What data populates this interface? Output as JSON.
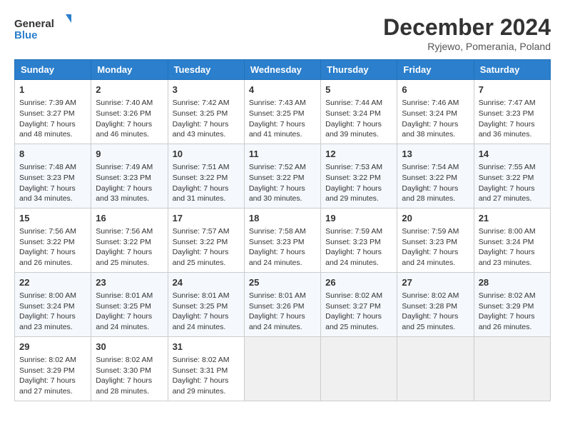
{
  "header": {
    "logo_line1": "General",
    "logo_line2": "Blue",
    "month": "December 2024",
    "location": "Ryjewo, Pomerania, Poland"
  },
  "weekdays": [
    "Sunday",
    "Monday",
    "Tuesday",
    "Wednesday",
    "Thursday",
    "Friday",
    "Saturday"
  ],
  "weeks": [
    [
      {
        "day": "1",
        "sunrise": "Sunrise: 7:39 AM",
        "sunset": "Sunset: 3:27 PM",
        "daylight": "Daylight: 7 hours and 48 minutes."
      },
      {
        "day": "2",
        "sunrise": "Sunrise: 7:40 AM",
        "sunset": "Sunset: 3:26 PM",
        "daylight": "Daylight: 7 hours and 46 minutes."
      },
      {
        "day": "3",
        "sunrise": "Sunrise: 7:42 AM",
        "sunset": "Sunset: 3:25 PM",
        "daylight": "Daylight: 7 hours and 43 minutes."
      },
      {
        "day": "4",
        "sunrise": "Sunrise: 7:43 AM",
        "sunset": "Sunset: 3:25 PM",
        "daylight": "Daylight: 7 hours and 41 minutes."
      },
      {
        "day": "5",
        "sunrise": "Sunrise: 7:44 AM",
        "sunset": "Sunset: 3:24 PM",
        "daylight": "Daylight: 7 hours and 39 minutes."
      },
      {
        "day": "6",
        "sunrise": "Sunrise: 7:46 AM",
        "sunset": "Sunset: 3:24 PM",
        "daylight": "Daylight: 7 hours and 38 minutes."
      },
      {
        "day": "7",
        "sunrise": "Sunrise: 7:47 AM",
        "sunset": "Sunset: 3:23 PM",
        "daylight": "Daylight: 7 hours and 36 minutes."
      }
    ],
    [
      {
        "day": "8",
        "sunrise": "Sunrise: 7:48 AM",
        "sunset": "Sunset: 3:23 PM",
        "daylight": "Daylight: 7 hours and 34 minutes."
      },
      {
        "day": "9",
        "sunrise": "Sunrise: 7:49 AM",
        "sunset": "Sunset: 3:23 PM",
        "daylight": "Daylight: 7 hours and 33 minutes."
      },
      {
        "day": "10",
        "sunrise": "Sunrise: 7:51 AM",
        "sunset": "Sunset: 3:22 PM",
        "daylight": "Daylight: 7 hours and 31 minutes."
      },
      {
        "day": "11",
        "sunrise": "Sunrise: 7:52 AM",
        "sunset": "Sunset: 3:22 PM",
        "daylight": "Daylight: 7 hours and 30 minutes."
      },
      {
        "day": "12",
        "sunrise": "Sunrise: 7:53 AM",
        "sunset": "Sunset: 3:22 PM",
        "daylight": "Daylight: 7 hours and 29 minutes."
      },
      {
        "day": "13",
        "sunrise": "Sunrise: 7:54 AM",
        "sunset": "Sunset: 3:22 PM",
        "daylight": "Daylight: 7 hours and 28 minutes."
      },
      {
        "day": "14",
        "sunrise": "Sunrise: 7:55 AM",
        "sunset": "Sunset: 3:22 PM",
        "daylight": "Daylight: 7 hours and 27 minutes."
      }
    ],
    [
      {
        "day": "15",
        "sunrise": "Sunrise: 7:56 AM",
        "sunset": "Sunset: 3:22 PM",
        "daylight": "Daylight: 7 hours and 26 minutes."
      },
      {
        "day": "16",
        "sunrise": "Sunrise: 7:56 AM",
        "sunset": "Sunset: 3:22 PM",
        "daylight": "Daylight: 7 hours and 25 minutes."
      },
      {
        "day": "17",
        "sunrise": "Sunrise: 7:57 AM",
        "sunset": "Sunset: 3:22 PM",
        "daylight": "Daylight: 7 hours and 25 minutes."
      },
      {
        "day": "18",
        "sunrise": "Sunrise: 7:58 AM",
        "sunset": "Sunset: 3:23 PM",
        "daylight": "Daylight: 7 hours and 24 minutes."
      },
      {
        "day": "19",
        "sunrise": "Sunrise: 7:59 AM",
        "sunset": "Sunset: 3:23 PM",
        "daylight": "Daylight: 7 hours and 24 minutes."
      },
      {
        "day": "20",
        "sunrise": "Sunrise: 7:59 AM",
        "sunset": "Sunset: 3:23 PM",
        "daylight": "Daylight: 7 hours and 24 minutes."
      },
      {
        "day": "21",
        "sunrise": "Sunrise: 8:00 AM",
        "sunset": "Sunset: 3:24 PM",
        "daylight": "Daylight: 7 hours and 23 minutes."
      }
    ],
    [
      {
        "day": "22",
        "sunrise": "Sunrise: 8:00 AM",
        "sunset": "Sunset: 3:24 PM",
        "daylight": "Daylight: 7 hours and 23 minutes."
      },
      {
        "day": "23",
        "sunrise": "Sunrise: 8:01 AM",
        "sunset": "Sunset: 3:25 PM",
        "daylight": "Daylight: 7 hours and 24 minutes."
      },
      {
        "day": "24",
        "sunrise": "Sunrise: 8:01 AM",
        "sunset": "Sunset: 3:25 PM",
        "daylight": "Daylight: 7 hours and 24 minutes."
      },
      {
        "day": "25",
        "sunrise": "Sunrise: 8:01 AM",
        "sunset": "Sunset: 3:26 PM",
        "daylight": "Daylight: 7 hours and 24 minutes."
      },
      {
        "day": "26",
        "sunrise": "Sunrise: 8:02 AM",
        "sunset": "Sunset: 3:27 PM",
        "daylight": "Daylight: 7 hours and 25 minutes."
      },
      {
        "day": "27",
        "sunrise": "Sunrise: 8:02 AM",
        "sunset": "Sunset: 3:28 PM",
        "daylight": "Daylight: 7 hours and 25 minutes."
      },
      {
        "day": "28",
        "sunrise": "Sunrise: 8:02 AM",
        "sunset": "Sunset: 3:29 PM",
        "daylight": "Daylight: 7 hours and 26 minutes."
      }
    ],
    [
      {
        "day": "29",
        "sunrise": "Sunrise: 8:02 AM",
        "sunset": "Sunset: 3:29 PM",
        "daylight": "Daylight: 7 hours and 27 minutes."
      },
      {
        "day": "30",
        "sunrise": "Sunrise: 8:02 AM",
        "sunset": "Sunset: 3:30 PM",
        "daylight": "Daylight: 7 hours and 28 minutes."
      },
      {
        "day": "31",
        "sunrise": "Sunrise: 8:02 AM",
        "sunset": "Sunset: 3:31 PM",
        "daylight": "Daylight: 7 hours and 29 minutes."
      },
      null,
      null,
      null,
      null
    ]
  ]
}
